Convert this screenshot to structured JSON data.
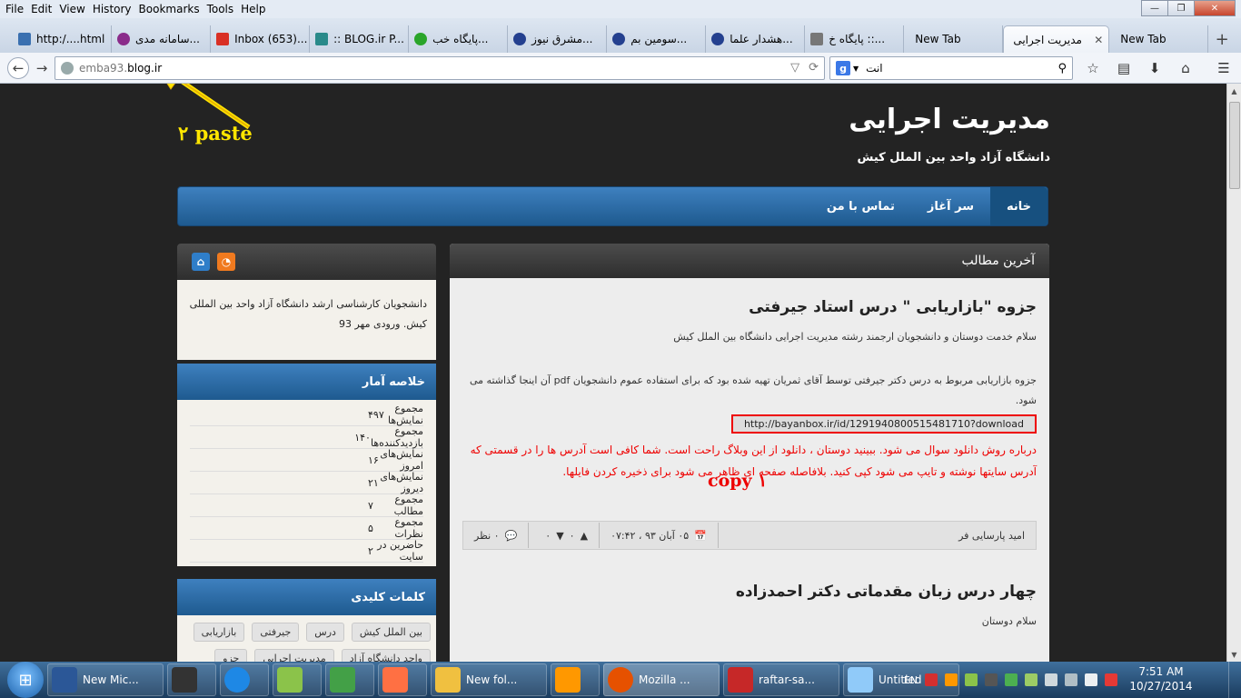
{
  "menubar": {
    "items": [
      "File",
      "Edit",
      "View",
      "History",
      "Bookmarks",
      "Tools",
      "Help"
    ],
    "window_buttons": {
      "minimize": "—",
      "maximize": "❐",
      "close": "✕"
    }
  },
  "tabs": [
    {
      "title": "http:/....html",
      "color": "#3a70b0"
    },
    {
      "title": "سامانه مدی...",
      "color": "#8a2b8a"
    },
    {
      "title": "Inbox (653)...",
      "color": "#d93025"
    },
    {
      "title": ":: BLOG.ir P...",
      "color": "#2a8a8a"
    },
    {
      "title": "پایگاه خب...",
      "color": "#2aa52a"
    },
    {
      "title": "مشرق نیوز...",
      "color": "#24408f"
    },
    {
      "title": "سومین بم...",
      "color": "#24408f"
    },
    {
      "title": "هشدار علما...",
      "color": "#24408f"
    },
    {
      "title": "پایگاه خ ::...",
      "color": "#777777"
    },
    {
      "title": "New Tab",
      "color": ""
    },
    {
      "title": "مدیریت اجرایی",
      "color": "",
      "active": true
    },
    {
      "title": "New Tab",
      "color": ""
    }
  ],
  "navbar": {
    "url_domain": "emba93.",
    "url_host": "blog.ir",
    "search_query": "انت"
  },
  "site": {
    "title": "مدیریت اجرایی",
    "subtitle": "دانشگاه آزاد واحد بین الملل کیش",
    "nav": [
      "خانه",
      "سر آغاز",
      "تماس با من"
    ]
  },
  "annotations": {
    "paste": "۲ paste",
    "copy": "copy ۱"
  },
  "main": {
    "heading": "آخرین مطالب",
    "post1": {
      "title": "جزوه \"بازاریابی \" درس استاد جیرفتی",
      "greeting": "سلام خدمت دوستان و دانشجویان ارجمند رشته مدیریت اجرایی دانشگاه بین الملل کیش",
      "body": "جزوه بازاریابی مربوط به درس دکتر جیرفتی توسط آقای ثمریان تهیه شده بود که برای استفاده عموم دانشجویان pdf آن اینجا گذاشته می شود.",
      "link": "http://bayanbox.ir/id/1291940800515481710?download",
      "note": "درباره روش دانلود سوال می شود. ببینید دوستان ، دانلود از این وبلاگ راحت است. شما کافی است آدرس ها را در قسمتی که آدرس سایتها نوشته و تایپ می شود کپی کنید. بلافاصله صفحه ای ظاهر می شود برای ذخیره کردن فایلها.",
      "author": "امید پارسایی فر",
      "date": "۰۵ آبان ۹۳ ، ۰۷:۴۲",
      "up": "۰",
      "down": "۰",
      "comments": "۰ نظر"
    },
    "post2": {
      "title": "چهار درس زبان مقدماتی دکتر احمدزاده",
      "greeting": "سلام دوستان"
    }
  },
  "sidebar": {
    "description": "دانشجویان کارشناسی ارشد دانشگاه آزاد واحد بین المللی کیش. ورودی مهر 93",
    "stats_heading": "خلاصه آمار",
    "stats": [
      {
        "label": "مجموع نمایش‌ها",
        "value": "۴۹۷"
      },
      {
        "label": "مجموع بازدیدکننده‌ها",
        "value": "۱۴۰"
      },
      {
        "label": "نمایش‌های امروز",
        "value": "۱۶"
      },
      {
        "label": "نمایش‌های دیروز",
        "value": "۲۱"
      },
      {
        "label": "مجموع مطالب",
        "value": "۷"
      },
      {
        "label": "مجموع نظرات",
        "value": "۵"
      },
      {
        "label": "حاضرین در سایت",
        "value": "۲"
      }
    ],
    "keywords_heading": "کلمات کلیدی",
    "keywords": [
      "بین الملل کیش",
      "درس",
      "جیرفتی",
      "بازاریابی",
      "واحد دانشگاه آزاد",
      "مدیریت اجرایی",
      "جزو"
    ]
  },
  "taskbar": {
    "buttons": [
      {
        "label": "New Mic...",
        "color": "#2b5797",
        "kind": "long"
      },
      {
        "label": "",
        "color": "#333333",
        "kind": "short"
      },
      {
        "label": "",
        "color": "#1e88e5",
        "kind": "short"
      },
      {
        "label": "",
        "color": "#8bc34a",
        "kind": "short"
      },
      {
        "label": "",
        "color": "#43a047",
        "kind": "short"
      },
      {
        "label": "",
        "color": "#ff7043",
        "kind": "short"
      },
      {
        "label": "New fol...",
        "color": "#f0c040",
        "kind": "long"
      },
      {
        "label": "",
        "color": "#ff9800",
        "kind": "short"
      },
      {
        "label": "Mozilla ...",
        "color": "#e65100",
        "kind": "long"
      },
      {
        "label": "raftar-sa...",
        "color": "#c62828",
        "kind": "long"
      },
      {
        "label": "Untitled ...",
        "color": "#90caf9",
        "kind": "long"
      }
    ],
    "lang": "EN",
    "time": "7:51 AM",
    "date": "10/27/2014"
  }
}
